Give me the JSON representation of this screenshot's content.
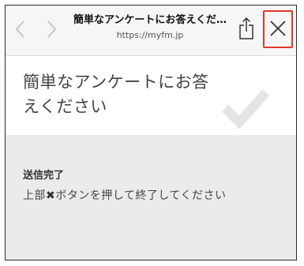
{
  "browser": {
    "page_title": "簡単なアンケートにお答えくだ…",
    "url": "https://myfm.jp",
    "back_icon": "chevron-left-icon",
    "forward_icon": "chevron-right-icon",
    "share_icon": "share-icon",
    "close_icon": "close-icon",
    "highlight_color": "#e0392b"
  },
  "hero": {
    "title": "簡単なアンケートにお答えください",
    "icon": "checkmark-icon"
  },
  "panel": {
    "heading": "送信完了",
    "message_before": "上部",
    "message_mark": "✖",
    "message_after": "ボタンを押して終了してください"
  }
}
